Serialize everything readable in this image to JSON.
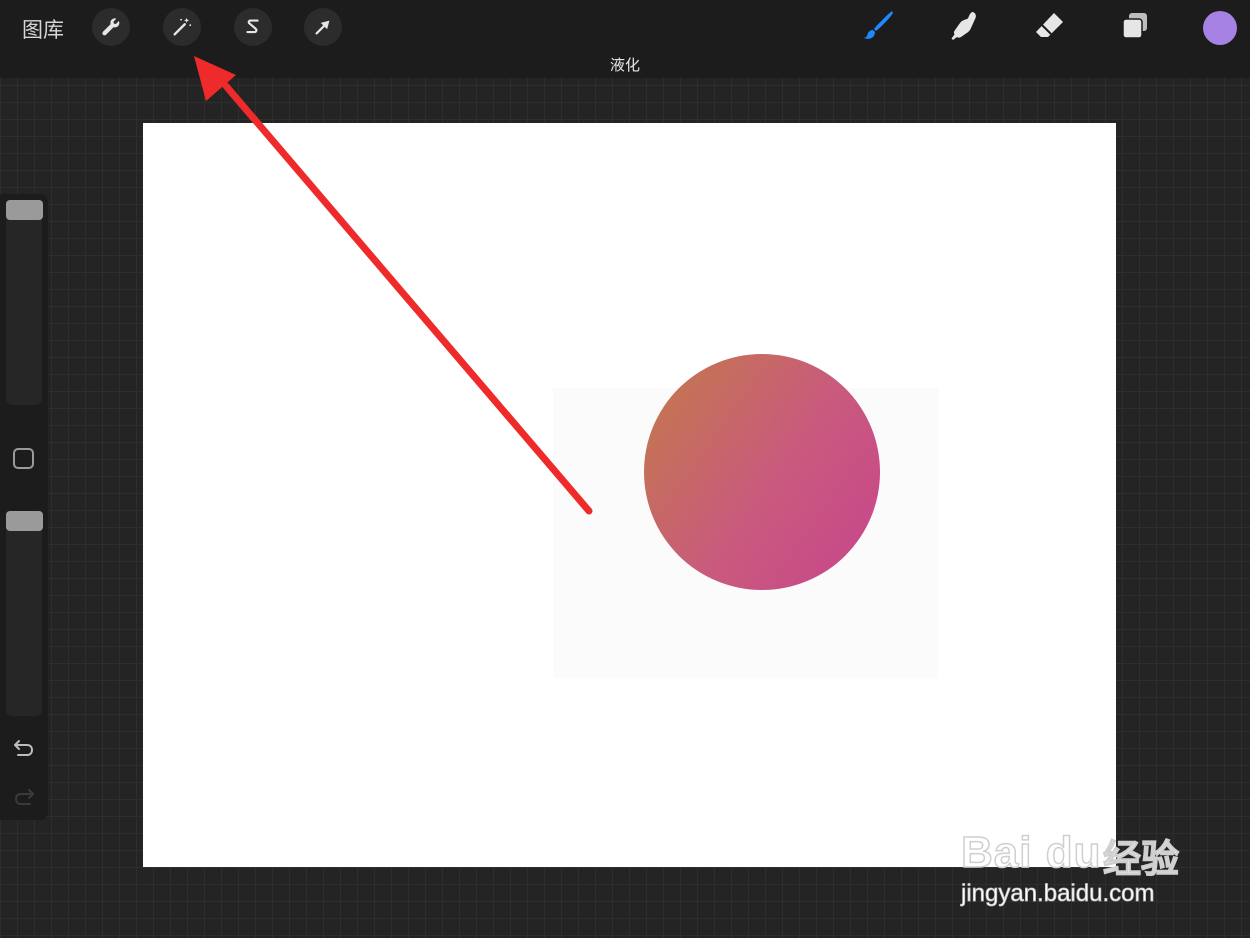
{
  "topbar": {
    "gallery_label": "图库",
    "status_label": "液化",
    "left_tools": [
      {
        "name": "actions",
        "icon": "wrench-icon"
      },
      {
        "name": "adjustments",
        "icon": "magic-wand-icon"
      },
      {
        "name": "selection",
        "icon": "selection-s-icon"
      },
      {
        "name": "transform",
        "icon": "arrow-cursor-icon"
      }
    ],
    "right_tools": [
      {
        "name": "brush",
        "icon": "brush-icon",
        "active": true
      },
      {
        "name": "smudge",
        "icon": "smudge-finger-icon"
      },
      {
        "name": "eraser",
        "icon": "eraser-icon"
      },
      {
        "name": "layers",
        "icon": "layers-icon"
      }
    ],
    "current_color": "#a682e4",
    "active_color": "#1e88ff"
  },
  "canvas": {
    "background": "#ffffff",
    "orb_gradient": [
      "#c37a48",
      "#c95a7e",
      "#c8448c"
    ]
  },
  "sidebar": {
    "brush_size": 0.0,
    "opacity": 0.0,
    "undo_icon": "undo-icon",
    "redo_icon": "redo-icon"
  },
  "annotation": {
    "arrow_color": "#ee2a2a"
  },
  "watermark": {
    "logo_text": "Bai  du",
    "cn_text": "经验",
    "url": "jingyan.baidu.com"
  }
}
